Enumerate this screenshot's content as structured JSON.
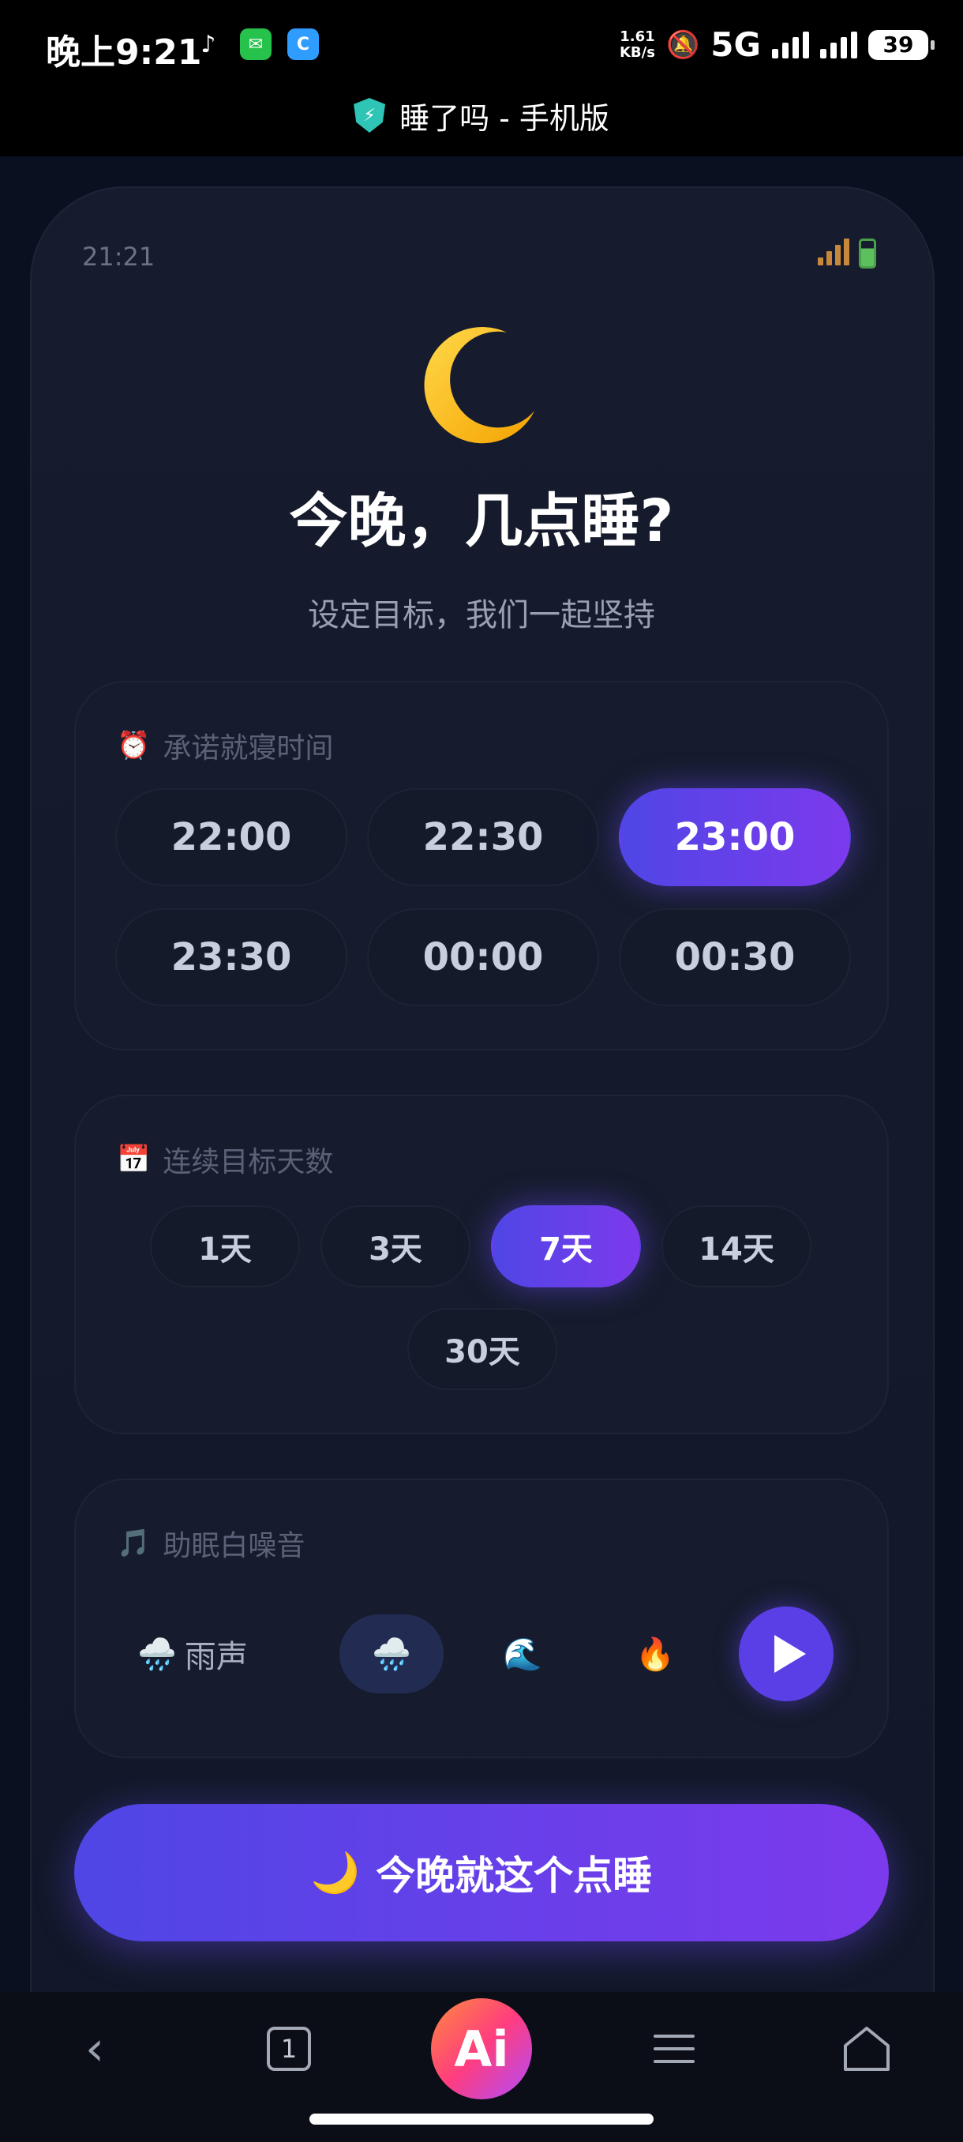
{
  "status_bar": {
    "time": "晚上9:21",
    "net_speed_top": "1.61",
    "net_speed_bottom": "KB/s",
    "network": "5G",
    "battery": "39"
  },
  "browser": {
    "page_title": "睡了吗 - 手机版"
  },
  "page": {
    "inner_time": "21:21",
    "headline": "今晚，几点睡?",
    "subtitle": "设定目标，我们一起坚持"
  },
  "bedtime": {
    "title": "承诺就寝时间",
    "icon": "alarm-clock-icon",
    "options": [
      "22:00",
      "22:30",
      "23:00",
      "23:30",
      "00:00",
      "00:30"
    ],
    "selected": "23:00"
  },
  "streak": {
    "title": "连续目标天数",
    "icon": "calendar-icon",
    "options": [
      "1天",
      "3天",
      "7天",
      "14天",
      "30天"
    ],
    "selected": "7天"
  },
  "white_noise": {
    "title": "助眠白噪音",
    "icon": "music-note-icon",
    "rain_label": "雨声"
  },
  "cta": {
    "label": "今晚就这个点睡"
  },
  "nav": {
    "tabs_count": "1",
    "ai_label": "Ai"
  },
  "colors": {
    "accent_start": "#4f46e5",
    "accent_end": "#7c3aed",
    "background": "#0b1020"
  }
}
